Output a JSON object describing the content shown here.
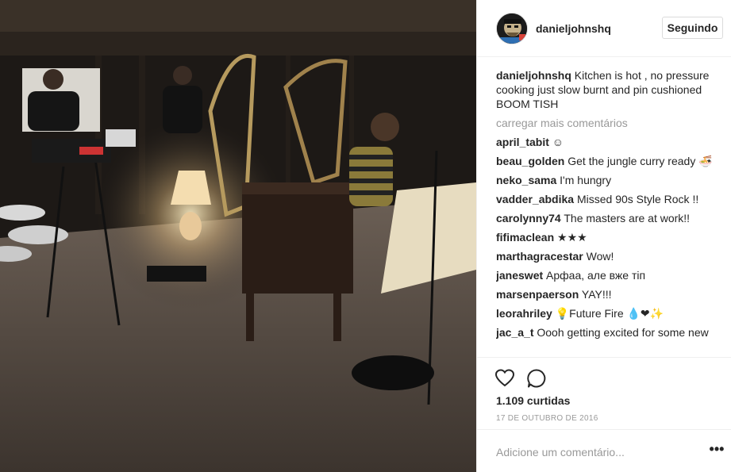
{
  "post": {
    "username": "danieljohnshq",
    "follow_label": "Seguindo",
    "caption_user": "danieljohnshq",
    "caption_text": "Kitchen is hot , no pressure cooking just slow burnt and pin cushioned BOOM TISH",
    "load_more": "carregar mais comentários",
    "likes": "1.109 curtidas",
    "date": "17 DE OUTUBRO DE 2016",
    "add_comment_placeholder": "Adicione um comentário...",
    "more_label": "•••"
  },
  "comments": [
    {
      "user": "april_tabit",
      "text": "☺"
    },
    {
      "user": "beau_golden",
      "text": "Get the jungle curry ready 🍜"
    },
    {
      "user": "neko_sama",
      "text": "I'm hungry"
    },
    {
      "user": "vadder_abdika",
      "text": "Missed 90s Style Rock !!"
    },
    {
      "user": "carolynny74",
      "text": "The masters are at work!!"
    },
    {
      "user": "fifimaclean",
      "text": "★★★"
    },
    {
      "user": "marthagracestar",
      "text": "Wow!"
    },
    {
      "user": "janeswet",
      "text": "Арфаа, але вже тіп"
    },
    {
      "user": "marsenpaerson",
      "text": "YAY!!!"
    },
    {
      "user": "leorahriley",
      "text": "💡Future Fire 💧❤✨"
    },
    {
      "user": "jac_a_t",
      "text": "Oooh getting excited for some new"
    }
  ],
  "icons": {
    "like": "heart-icon",
    "comment": "comment-icon",
    "more": "ellipsis-icon"
  },
  "colors": {
    "text": "#262626",
    "muted": "#999999",
    "border": "#efefef"
  }
}
